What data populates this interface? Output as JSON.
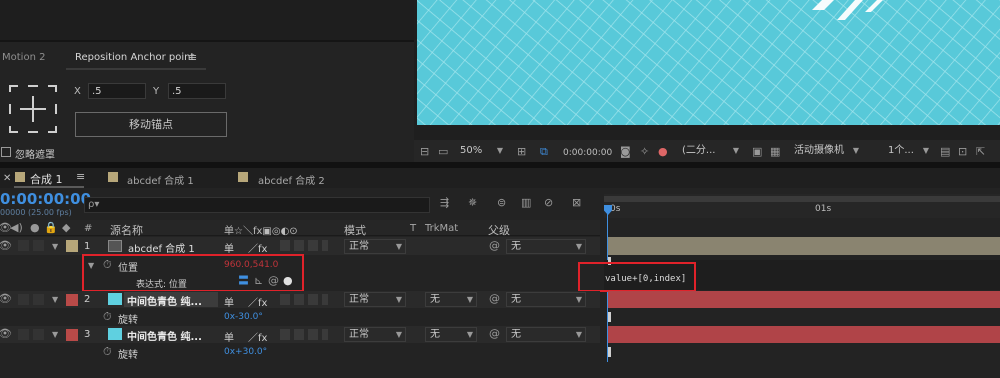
{
  "effects_panel": {
    "tab_motion2": "Motion 2",
    "tab_reposition": "Reposition Anchor point",
    "menu_glyph": "≡",
    "x_label": "X",
    "x_value": ".5",
    "y_label": "Y",
    "y_value": ".5",
    "move_anchor_button": "移动锚点",
    "ignore_mask_label": "忽略遮罩"
  },
  "viewer_toolbar": {
    "zoom": "50%",
    "timecode": "0:00:00:00",
    "resolution": "(二分...",
    "camera": "活动摄像机",
    "views": "1个..."
  },
  "timeline": {
    "tabs": [
      {
        "label": "合成 1",
        "color": "#b7a77a"
      },
      {
        "label": "abcdef 合成 1",
        "color": "#b7a77a"
      },
      {
        "label": "abcdef 合成 2",
        "color": "#b7a77a"
      }
    ],
    "timecode": "0:00:00:00",
    "fps": "00000 (25.00 fps)",
    "search_icon": "ρ▾",
    "ruler": {
      "start": "0s",
      "mark": "01s"
    },
    "headers": {
      "number": "#",
      "source_name": "源名称",
      "switches": "单☆＼fx▣◎◐⊙",
      "mode": "模式",
      "t": "T",
      "trkmat": "TrkMat",
      "parent": "父级"
    },
    "layers": [
      {
        "number": "1",
        "name": "abcdef 合成 1",
        "label_color": "#b7a77a",
        "mode": "正常",
        "trkmat": "",
        "parent": "无",
        "prop_name": "位置",
        "prop_value": "960.0,541.0",
        "expr_label": "表达式: 位置",
        "expression": "value+[0,index]"
      },
      {
        "number": "2",
        "name": "中间色青色 纯...",
        "label_color": "#b94a48",
        "mode": "正常",
        "trkmat": "无",
        "parent": "无",
        "prop_name": "旋转",
        "prop_value": "0x-30.0°"
      },
      {
        "number": "3",
        "name": "中间色青色 纯...",
        "label_color": "#b94a48",
        "mode": "正常",
        "trkmat": "无",
        "parent": "无",
        "prop_name": "旋转",
        "prop_value": "0x+30.0°"
      }
    ],
    "switch_glyph": "单",
    "fx_glyph": "／fx"
  },
  "colors": {
    "accent_blue": "#3f8fe0",
    "preview_cyan": "#55c8d8",
    "layer_cyan": "#5fd0e0",
    "bar_red": "#b04448",
    "bar_tan": "#8a8470",
    "highlight_red": "#e0222a"
  }
}
